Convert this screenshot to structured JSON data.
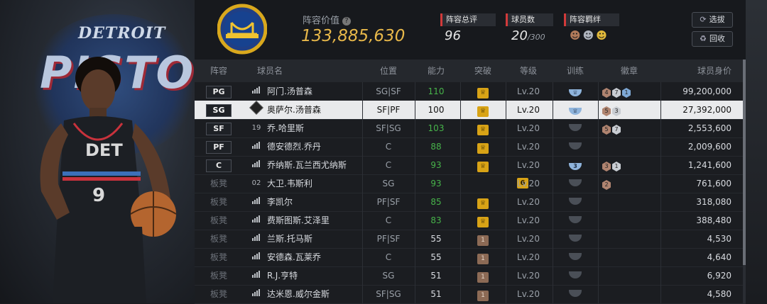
{
  "team": {
    "logo_icon": "golden-state-warriors-logo-icon",
    "art_title_small": "DETROIT",
    "art_title_big": "PISTONS",
    "jersey_text": "DET",
    "jersey_number": "9"
  },
  "header": {
    "lineup_value_label": "阵容价值",
    "lineup_value": "133,885,630",
    "rating_label": "阵容总评",
    "rating_value": "96",
    "players_label": "球员数",
    "players_value": "20",
    "players_max": "/300",
    "bond_label": "阵容羁绊",
    "buttons": [
      {
        "label": "选拔",
        "icon": "refresh-icon"
      },
      {
        "label": "回收",
        "icon": "recycle-icon"
      }
    ]
  },
  "columns": [
    "阵容",
    "球员名",
    "位置",
    "能力",
    "突破",
    "等级",
    "训练",
    "徽章",
    "球员身价"
  ],
  "rows": [
    {
      "slot": "PG",
      "bench": false,
      "icon": "signal",
      "num": "",
      "name": "阿门.汤普森",
      "pos": "SG|SF",
      "ability": "110",
      "green": true,
      "break": "crown",
      "level": "Lv.20",
      "train": "blue",
      "train_num": "",
      "badges": [
        {
          "c": "bronze",
          "t": "4"
        },
        {
          "c": "silver",
          "t": "7"
        },
        {
          "c": "blue",
          "t": "1"
        }
      ],
      "value": "99,200,000",
      "selected": false
    },
    {
      "slot": "SG",
      "bench": false,
      "icon": "diamond",
      "num": "",
      "name": "奥萨尔.汤普森",
      "pos": "SF|PF",
      "ability": "100",
      "green": false,
      "break": "crown",
      "level": "Lv.20",
      "train": "blue",
      "train_num": "",
      "badges": [
        {
          "c": "bronze",
          "t": "5"
        },
        {
          "c": "silver",
          "t": "3"
        }
      ],
      "value": "27,392,000",
      "selected": true
    },
    {
      "slot": "SF",
      "bench": false,
      "icon": "num",
      "num": "19",
      "name": "乔.哈里斯",
      "pos": "SF|SG",
      "ability": "103",
      "green": true,
      "break": "crown",
      "level": "Lv.20",
      "train": "gray",
      "train_num": "",
      "badges": [
        {
          "c": "bronze",
          "t": "5"
        },
        {
          "c": "silver",
          "t": "7"
        }
      ],
      "value": "2,553,600",
      "selected": false
    },
    {
      "slot": "PF",
      "bench": false,
      "icon": "signal",
      "num": "",
      "name": "德安德烈.乔丹",
      "pos": "C",
      "ability": "88",
      "green": true,
      "break": "crown",
      "level": "Lv.20",
      "train": "gray",
      "train_num": "",
      "badges": [],
      "value": "2,009,600",
      "selected": false
    },
    {
      "slot": "C",
      "bench": false,
      "icon": "signal",
      "num": "",
      "name": "乔纳斯.瓦兰西尤纳斯",
      "pos": "C",
      "ability": "93",
      "green": true,
      "break": "crown",
      "level": "Lv.20",
      "train": "blue",
      "train_num": "3",
      "badges": [
        {
          "c": "bronze",
          "t": "3"
        },
        {
          "c": "silver",
          "t": "1"
        }
      ],
      "value": "1,241,600",
      "selected": false
    },
    {
      "slot": "板凳",
      "bench": true,
      "icon": "num",
      "num": "02",
      "name": "大卫.韦斯利",
      "pos": "SG",
      "ability": "93",
      "green": true,
      "break": "num6",
      "level": "Lv.20",
      "train": "gray",
      "train_num": "",
      "badges": [
        {
          "c": "bronze",
          "t": "2"
        }
      ],
      "value": "761,600",
      "selected": false
    },
    {
      "slot": "板凳",
      "bench": true,
      "icon": "signal",
      "num": "",
      "name": "李凯尔",
      "pos": "PF|SF",
      "ability": "85",
      "green": true,
      "break": "crown",
      "level": "Lv.20",
      "train": "gray",
      "train_num": "",
      "badges": [],
      "value": "318,080",
      "selected": false
    },
    {
      "slot": "板凳",
      "bench": true,
      "icon": "signal",
      "num": "",
      "name": "费斯图斯.艾泽里",
      "pos": "C",
      "ability": "83",
      "green": true,
      "break": "crown",
      "level": "Lv.20",
      "train": "gray",
      "train_num": "",
      "badges": [],
      "value": "388,480",
      "selected": false
    },
    {
      "slot": "板凳",
      "bench": true,
      "icon": "signal",
      "num": "",
      "name": "兰斯.托马斯",
      "pos": "PF|SF",
      "ability": "55",
      "green": false,
      "break": "brown1",
      "level": "Lv.20",
      "train": "gray",
      "train_num": "",
      "badges": [],
      "value": "4,530",
      "selected": false
    },
    {
      "slot": "板凳",
      "bench": true,
      "icon": "signal",
      "num": "",
      "name": "安德森.瓦莱乔",
      "pos": "C",
      "ability": "55",
      "green": false,
      "break": "brown1",
      "level": "Lv.20",
      "train": "gray",
      "train_num": "",
      "badges": [],
      "value": "4,640",
      "selected": false
    },
    {
      "slot": "板凳",
      "bench": true,
      "icon": "signal",
      "num": "",
      "name": "R.J.亨特",
      "pos": "SG",
      "ability": "51",
      "green": false,
      "break": "brown1",
      "level": "Lv.20",
      "train": "gray",
      "train_num": "",
      "badges": [],
      "value": "6,920",
      "selected": false
    },
    {
      "slot": "板凳",
      "bench": true,
      "icon": "signal",
      "num": "",
      "name": "达米恩.威尔金斯",
      "pos": "SF|SG",
      "ability": "51",
      "green": false,
      "break": "brown1",
      "level": "Lv.20",
      "train": "gray",
      "train_num": "",
      "badges": [],
      "value": "4,580",
      "selected": false
    }
  ]
}
